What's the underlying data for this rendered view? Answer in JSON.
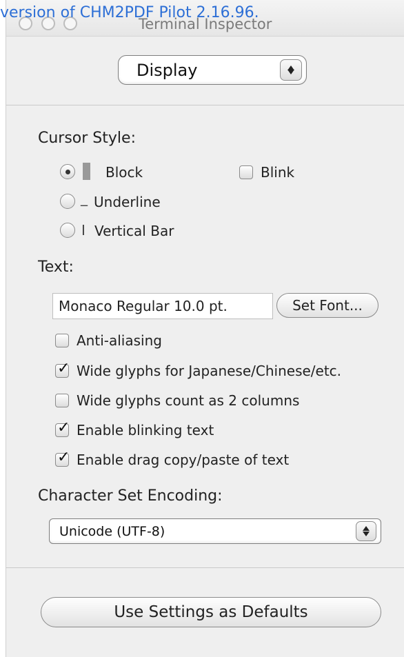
{
  "watermark": "version of CHM2PDF Pilot 2.16.96.",
  "window": {
    "title": "Terminal Inspector"
  },
  "inspector_pane": {
    "selected": "Display"
  },
  "cursor_style": {
    "heading": "Cursor Style:",
    "options": [
      {
        "label": "Block",
        "glyph": "█",
        "selected": true
      },
      {
        "label": "Underline",
        "glyph": "_",
        "selected": false
      },
      {
        "label": "Vertical Bar",
        "glyph": "I",
        "selected": false
      }
    ],
    "blink": {
      "label": "Blink",
      "checked": false
    }
  },
  "text": {
    "heading": "Text:",
    "font_value": "Monaco Regular 10.0 pt.",
    "set_font_label": "Set Font...",
    "options": [
      {
        "label": "Anti-aliasing",
        "checked": false
      },
      {
        "label": "Wide glyphs for Japanese/Chinese/etc.",
        "checked": true
      },
      {
        "label": "Wide glyphs count as 2 columns",
        "checked": false
      },
      {
        "label": "Enable blinking text",
        "checked": true
      },
      {
        "label": "Enable drag copy/paste of text",
        "checked": true
      }
    ]
  },
  "encoding": {
    "heading": "Character Set Encoding:",
    "selected": "Unicode (UTF-8)"
  },
  "defaults_button_label": "Use Settings as Defaults"
}
